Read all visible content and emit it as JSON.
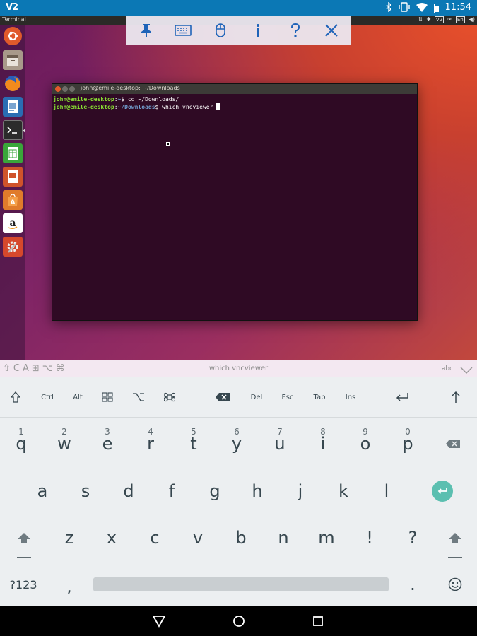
{
  "status_bar": {
    "app_label": "V2",
    "time": "11:54",
    "icons": [
      "bluetooth-icon",
      "vibrate-icon",
      "wifi-icon",
      "battery-icon"
    ]
  },
  "remote_topbar": {
    "window_title": "Terminal",
    "indicator_box": "V2",
    "keyboard_layout": "En"
  },
  "launcher": {
    "items": [
      {
        "name": "ubuntu-dash",
        "color": "#e05a2b"
      },
      {
        "name": "files",
        "color": "#9c8b7a"
      },
      {
        "name": "firefox",
        "color": "#e66000"
      },
      {
        "name": "libreoffice-writer",
        "color": "#2a6db3"
      },
      {
        "name": "terminal",
        "color": "#2b2b2b"
      },
      {
        "name": "libreoffice-calc",
        "color": "#3aa53a"
      },
      {
        "name": "libreoffice-impress",
        "color": "#d0532b"
      },
      {
        "name": "ubuntu-software",
        "color": "#e07b2b"
      },
      {
        "name": "amazon",
        "color": "#ffffff"
      },
      {
        "name": "system-settings",
        "color": "#d6482c"
      }
    ]
  },
  "terminal": {
    "title": "john@emile-desktop: ~/Downloads",
    "line1_user": "john@emile-desktop",
    "line1_sep": ":",
    "line1_path": "~",
    "line1_cmd": "$ cd ~/Downloads/",
    "line2_user": "john@emile-desktop",
    "line2_sep": ":",
    "line2_path": "~/Downloads",
    "line2_cmd": "$ which vncviewer"
  },
  "extra_strip": {
    "modifier_symbols": [
      "⇧",
      "C",
      "A",
      "⊞",
      "⌥",
      "⌘"
    ],
    "typed_text": "which vncviewer",
    "mode_label": "abc"
  },
  "keyboard": {
    "extra_keys": {
      "ctrl": "Ctrl",
      "alt": "Alt",
      "del": "Del",
      "esc": "Esc",
      "tab": "Tab",
      "ins": "Ins"
    },
    "row1": [
      {
        "k": "q",
        "h": "1"
      },
      {
        "k": "w",
        "h": "2"
      },
      {
        "k": "e",
        "h": "3"
      },
      {
        "k": "r",
        "h": "4"
      },
      {
        "k": "t",
        "h": "5"
      },
      {
        "k": "y",
        "h": "6"
      },
      {
        "k": "u",
        "h": "7"
      },
      {
        "k": "i",
        "h": "8"
      },
      {
        "k": "o",
        "h": "9"
      },
      {
        "k": "p",
        "h": "0"
      }
    ],
    "row2": [
      "a",
      "s",
      "d",
      "f",
      "g",
      "h",
      "j",
      "k",
      "l"
    ],
    "row3": [
      "z",
      "x",
      "c",
      "v",
      "b",
      "n",
      "m",
      "!",
      "?"
    ],
    "symbols_key": "?123",
    "comma_key": ",",
    "period_key": ".",
    "accent_color": "#5bbfb0"
  }
}
